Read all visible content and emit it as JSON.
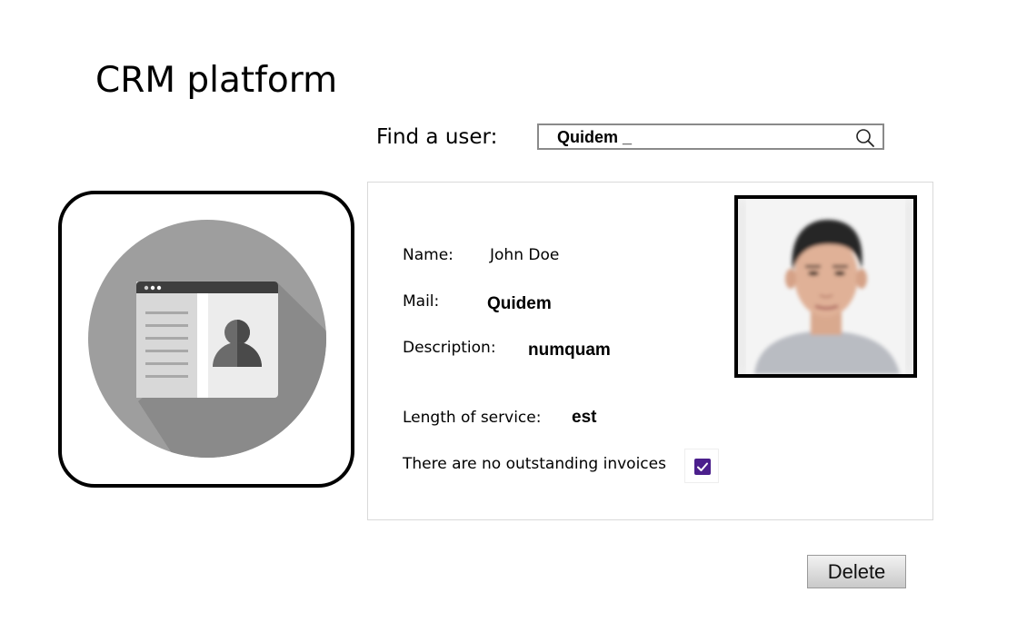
{
  "app": {
    "title": "CRM platform"
  },
  "search": {
    "label": "Find a user:",
    "value": "Quidem _"
  },
  "user": {
    "name_label": "Name:",
    "name_value": "John Doe",
    "mail_label": "Mail:",
    "mail_value": "Quidem",
    "description_label": "Description:",
    "description_value": "numquam",
    "service_label": "Length of service:",
    "service_value": "est",
    "invoices_label": "There are no outstanding invoices",
    "invoices_checked": true
  },
  "actions": {
    "delete_label": "Delete"
  },
  "icons": {
    "search": "search-icon",
    "contact_card": "contact-card-icon",
    "check": "check-icon"
  },
  "colors": {
    "checkbox_accent": "#4b1f8c",
    "avatar_circle": "#9e9e9e"
  }
}
